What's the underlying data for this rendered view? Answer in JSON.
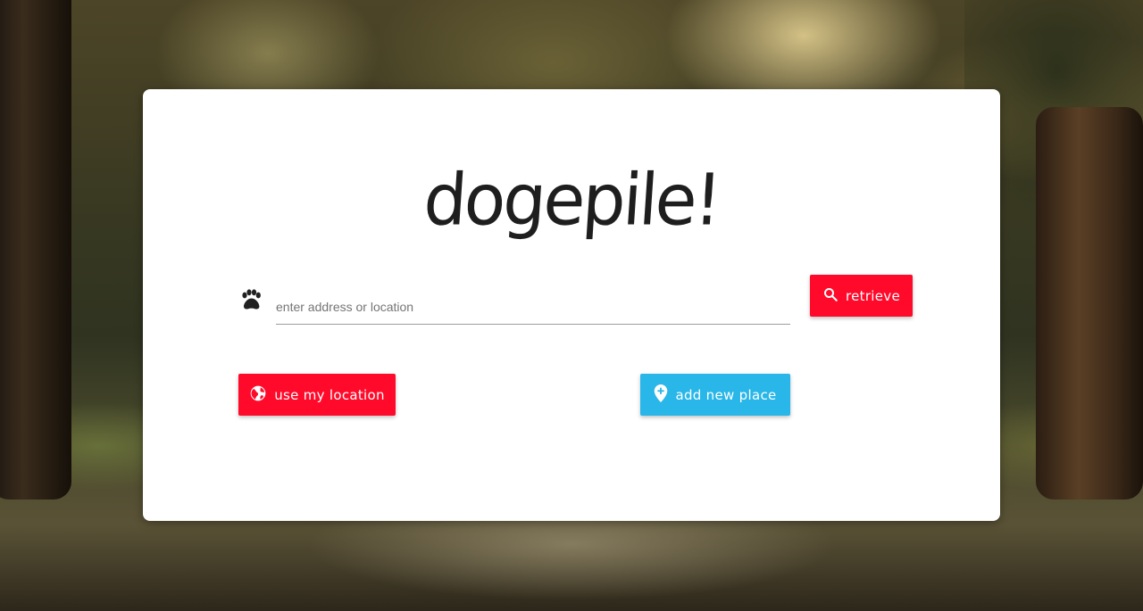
{
  "app": {
    "logo_text": "dogepile!"
  },
  "search": {
    "placeholder": "enter address or location",
    "value": ""
  },
  "buttons": {
    "retrieve_label": "retrieve",
    "use_location_label": "use my location",
    "add_place_label": "add new place"
  },
  "icons": {
    "input_icon": "paw-icon",
    "retrieve_icon": "search-icon",
    "location_icon": "globe-icon",
    "add_place_icon": "add-location-pin-icon"
  },
  "colors": {
    "primary_red": "#ff0a2a",
    "accent_blue": "#29b6e8",
    "card_bg": "#ffffff",
    "logo_text": "#1e1e1e"
  }
}
